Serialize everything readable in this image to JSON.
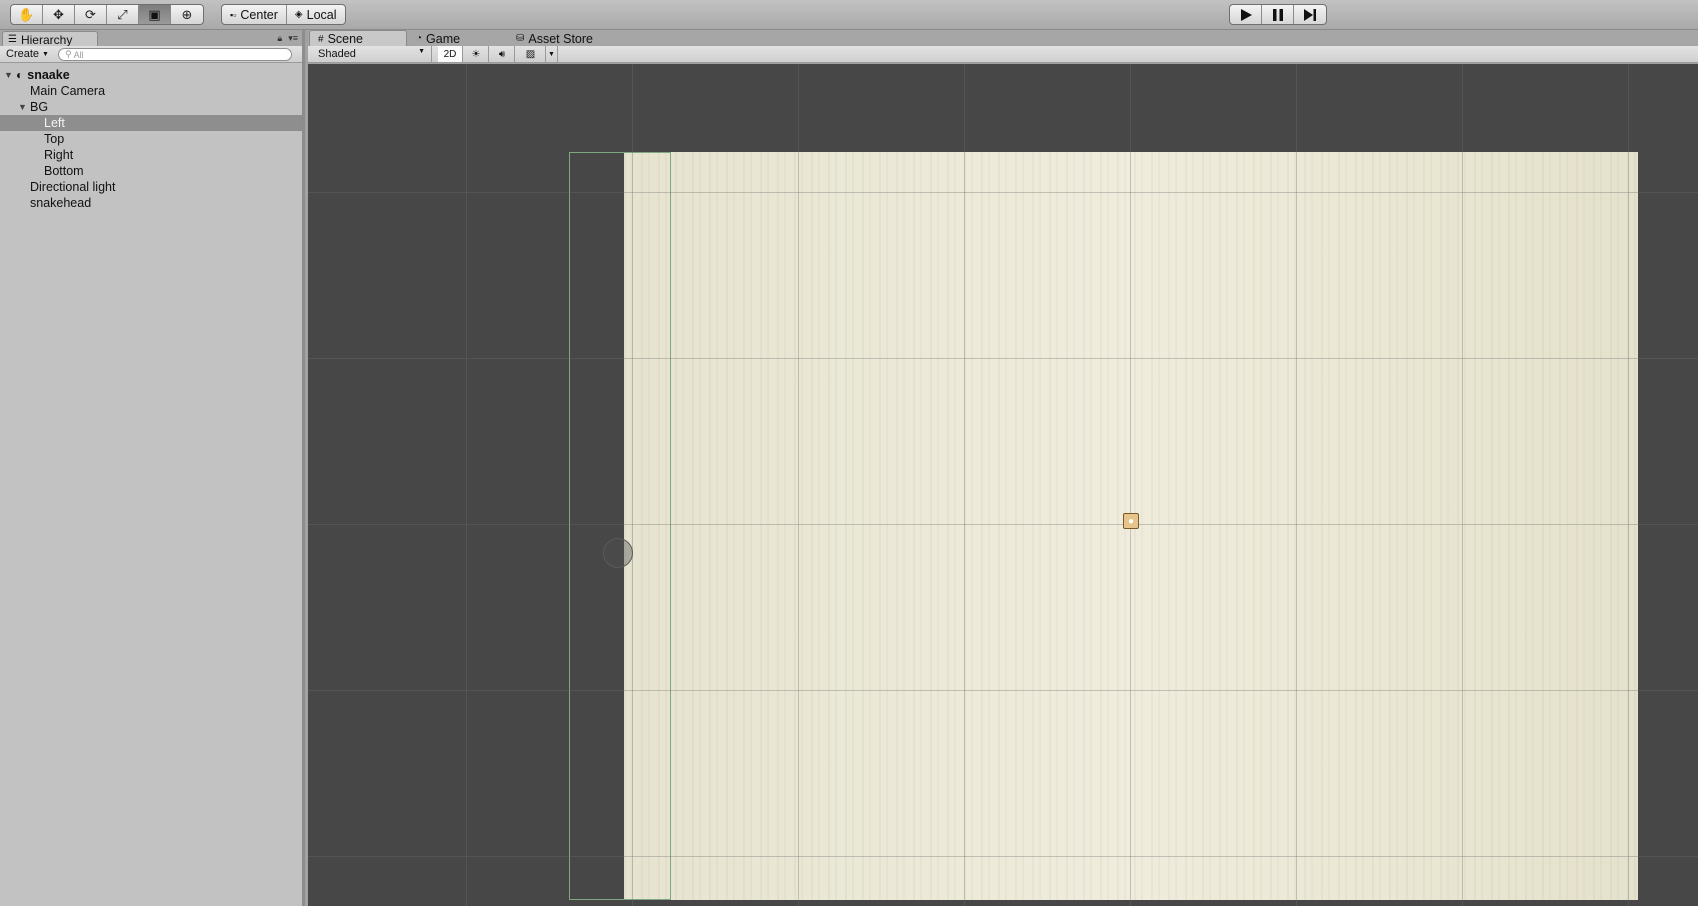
{
  "toolbar": {
    "transform_tools": [
      "hand-tool",
      "move-tool",
      "rotate-tool",
      "scale-tool",
      "rect-tool",
      "transform-tool"
    ],
    "active_tool": "rect-tool",
    "pivot_label": "Center",
    "space_label": "Local",
    "playback": [
      "play",
      "pause",
      "step"
    ]
  },
  "hierarchy": {
    "tab_label": "Hierarchy",
    "create_label": "Create",
    "search_placeholder": "All",
    "scene_name": "snaake",
    "items": [
      {
        "label": "Main Camera",
        "depth": 1
      },
      {
        "label": "BG",
        "depth": 1,
        "expanded": true
      },
      {
        "label": "Left",
        "depth": 2,
        "selected": true
      },
      {
        "label": "Top",
        "depth": 2
      },
      {
        "label": "Right",
        "depth": 2
      },
      {
        "label": "Bottom",
        "depth": 2
      },
      {
        "label": "Directional light",
        "depth": 1
      },
      {
        "label": "snakehead",
        "depth": 1
      }
    ]
  },
  "scene_view": {
    "tabs": [
      {
        "label": "Scene",
        "active": true
      },
      {
        "label": "Game",
        "active": false
      },
      {
        "label": "Asset Store",
        "active": false
      }
    ],
    "shading_mode": "Shaded",
    "mode_2d_label": "2D",
    "colors": {
      "viewport_bg": "#474747",
      "sprite_bg": "#ece9d8",
      "selection_outline": "#7fa77f"
    }
  }
}
